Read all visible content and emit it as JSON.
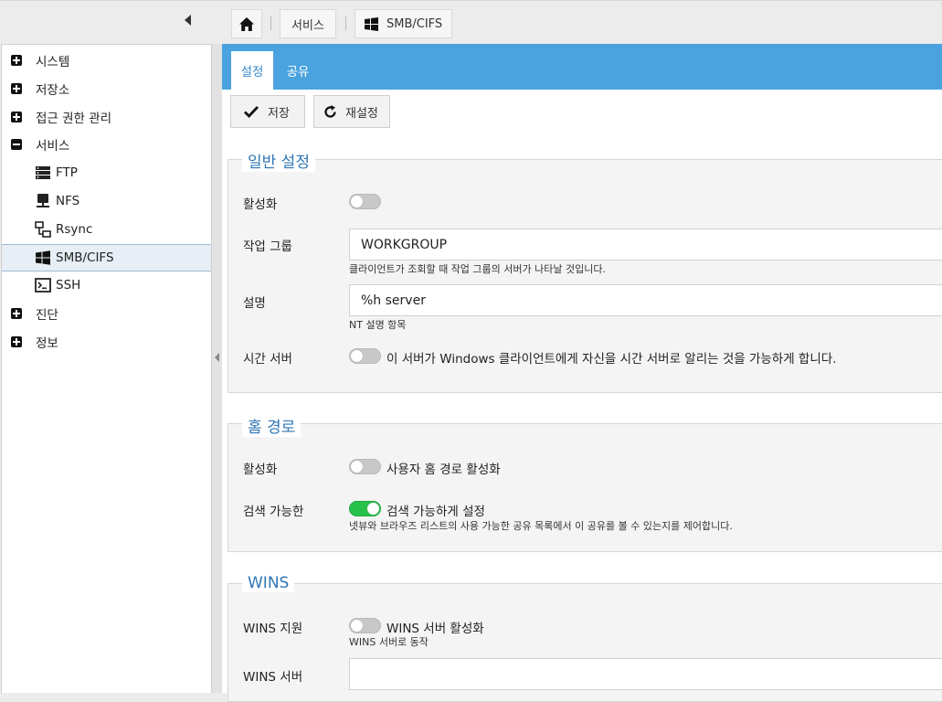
{
  "breadcrumb": {
    "home_icon": "home-icon",
    "services": "서비스",
    "current": "SMB/CIFS",
    "current_icon": "windows-icon"
  },
  "sidebar": {
    "items": [
      {
        "label": "시스템",
        "icon": "plus-square-icon"
      },
      {
        "label": "저장소",
        "icon": "plus-square-icon"
      },
      {
        "label": "접근 권한 관리",
        "icon": "plus-square-icon"
      },
      {
        "label": "서비스",
        "icon": "minus-square-icon"
      },
      {
        "label": "FTP",
        "icon": "server-icon"
      },
      {
        "label": "NFS",
        "icon": "network-drive-icon"
      },
      {
        "label": "Rsync",
        "icon": "sync-network-icon"
      },
      {
        "label": "SMB/CIFS",
        "icon": "windows-icon"
      },
      {
        "label": "SSH",
        "icon": "terminal-icon"
      },
      {
        "label": "진단",
        "icon": "plus-square-icon"
      },
      {
        "label": "정보",
        "icon": "plus-square-icon"
      }
    ],
    "selected": "SMB/CIFS"
  },
  "tabs": [
    {
      "label": "설정",
      "active": true
    },
    {
      "label": "공유",
      "active": false
    }
  ],
  "toolbar": {
    "save_label": "저장",
    "reset_label": "재설정"
  },
  "general": {
    "title": "일반 설정",
    "enable_label": "활성화",
    "enable_value": false,
    "workgroup_label": "작업 그룹",
    "workgroup_value": "WORKGROUP",
    "workgroup_help": "클라이언트가 조회할 때 작업 그룹의 서버가 나타날 것입니다.",
    "desc_label": "설명",
    "desc_value": "%h server",
    "desc_help": "NT 설명 항목",
    "timeserver_label": "시간 서버",
    "timeserver_value": false,
    "timeserver_text": "이 서버가 Windows 클라이언트에게 자신을 시간 서버로 알리는 것을 가능하게 합니다."
  },
  "home": {
    "title": "홈 경로",
    "enable_label": "활성화",
    "enable_value": false,
    "enable_text": "사용자 홈 경로 활성화",
    "browse_label": "검색 가능한",
    "browse_value": true,
    "browse_text": "검색 가능하게 설정",
    "browse_help": "넷뷰와 브라우즈 리스트의 사용 가능한 공유 목록에서 이 공유를 볼 수 있는지를 제어합니다."
  },
  "wins": {
    "title": "WINS",
    "support_label": "WINS 지원",
    "support_value": false,
    "support_text": "WINS 서버 활성화",
    "support_help": "WINS 서버로 동작",
    "server_label": "WINS 서버",
    "server_value": ""
  },
  "colors": {
    "accent": "#4aa3df",
    "legend": "#2f76b5",
    "toggle_on": "#27c24c"
  }
}
